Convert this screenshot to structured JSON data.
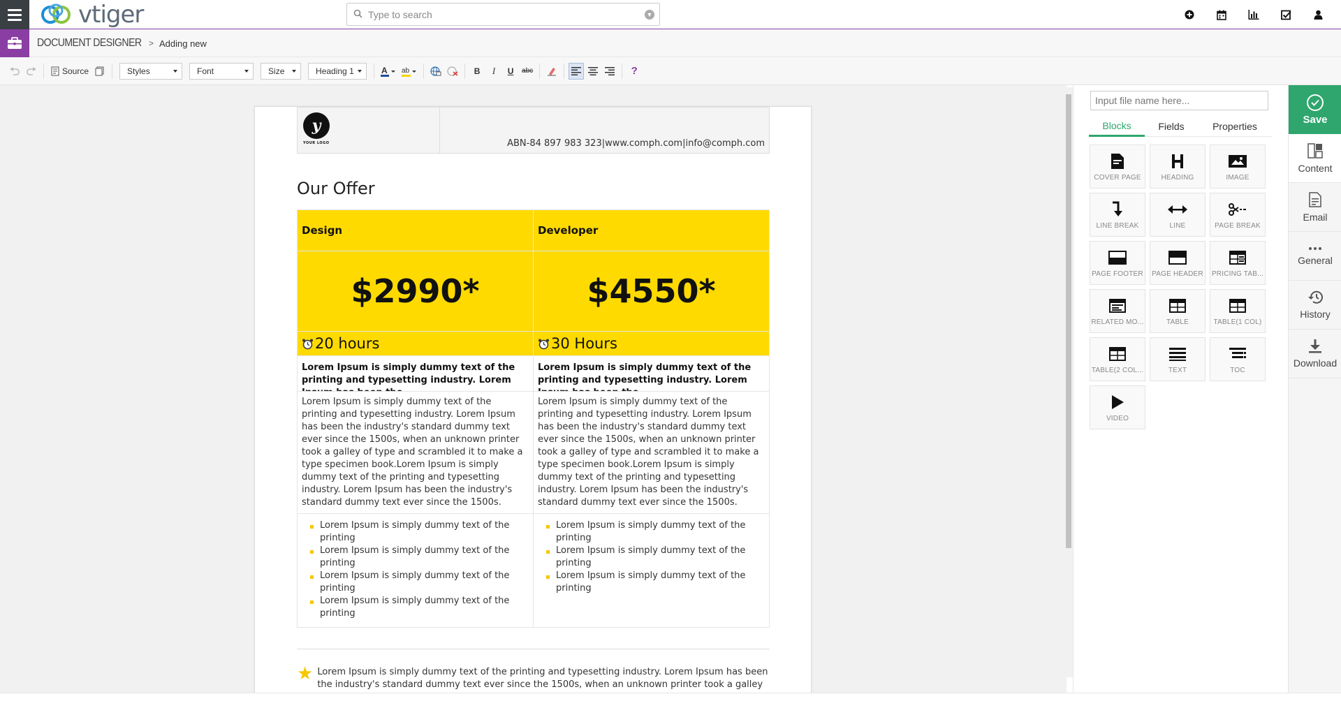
{
  "topbar": {
    "logo_text": "vtiger",
    "search_placeholder": "Type to search",
    "icons": [
      "plus-circle-icon",
      "calendar-icon",
      "bar-chart-icon",
      "check-square-icon",
      "user-icon"
    ]
  },
  "breadcrumb": {
    "module": "DOCUMENT DESIGNER",
    "separator": ">",
    "current": "Adding new"
  },
  "toolbar": {
    "source_label": "Source",
    "styles_label": "Styles",
    "font_label": "Font",
    "size_label": "Size",
    "format_label": "Heading 1",
    "bold": "B",
    "italic": "I",
    "underline": "U",
    "strike": "abc",
    "help": "?"
  },
  "document": {
    "contact_line": "ABN-84 897 983 323|www.comph.com|info@comph.com",
    "logo_letter": "y",
    "logo_caption": "YOUR LOGO",
    "title": "Our Offer",
    "plans": [
      {
        "name": "Design",
        "price": "$2990*",
        "hours": "20 hours",
        "lead": "Lorem Ipsum is simply dummy text of the printing and typesetting industry. Lorem Ipsum has been the",
        "body": "Lorem Ipsum is simply dummy text of the printing and typesetting industry. Lorem Ipsum has been the industry's standard dummy text ever since the 1500s, when an unknown printer took a galley of type and scrambled it to make a type specimen book.Lorem Ipsum is simply dummy text of the printing and typesetting industry. Lorem Ipsum has been the industry's standard dummy text ever since the 1500s.",
        "bullets": [
          "Lorem Ipsum is simply dummy text of the printing",
          "Lorem Ipsum is simply dummy text of the printing",
          "Lorem Ipsum is simply dummy text of the printing",
          "Lorem Ipsum is simply dummy text of the printing"
        ]
      },
      {
        "name": "Developer",
        "price": "$4550*",
        "hours": "30 Hours",
        "lead": "Lorem Ipsum is simply dummy text of the printing and typesetting industry. Lorem Ipsum has been the",
        "body": "Lorem Ipsum is simply dummy text of the printing and typesetting industry. Lorem Ipsum has been the industry's standard dummy text ever since the 1500s, when an unknown printer took a galley of type and scrambled it to make a type specimen book.Lorem Ipsum is simply dummy text of the printing and typesetting industry. Lorem Ipsum has been the industry's standard dummy text ever since the 1500s.",
        "bullets": [
          "Lorem Ipsum is simply dummy text of the printing",
          "Lorem Ipsum is simply dummy text of the printing",
          "Lorem Ipsum is simply dummy text of the printing"
        ]
      }
    ],
    "footer_note": "Lorem Ipsum is simply dummy text of the printing and typesetting industry. Lorem Ipsum has been the industry's standard dummy text ever since the 1500s, when an unknown printer took a galley of type and"
  },
  "panel": {
    "file_placeholder": "Input file name here...",
    "tabs": [
      "Blocks",
      "Fields",
      "Properties"
    ],
    "active_tab": "Blocks",
    "blocks": [
      {
        "label": "COVER PAGE",
        "icon": "cover-page-icon"
      },
      {
        "label": "HEADING",
        "icon": "heading-icon"
      },
      {
        "label": "IMAGE",
        "icon": "image-icon"
      },
      {
        "label": "LINE BREAK",
        "icon": "line-break-icon"
      },
      {
        "label": "LINE",
        "icon": "line-icon"
      },
      {
        "label": "PAGE BREAK",
        "icon": "page-break-icon"
      },
      {
        "label": "PAGE FOOTER",
        "icon": "page-footer-icon"
      },
      {
        "label": "PAGE HEADER",
        "icon": "page-header-icon"
      },
      {
        "label": "PRICING TAB...",
        "icon": "pricing-table-icon"
      },
      {
        "label": "RELATED MO...",
        "icon": "related-modules-icon"
      },
      {
        "label": "TABLE",
        "icon": "table-icon"
      },
      {
        "label": "TABLE(1 COL)",
        "icon": "table-1-col-icon"
      },
      {
        "label": "TABLE(2 COL...",
        "icon": "table-2-col-icon"
      },
      {
        "label": "TEXT",
        "icon": "text-icon"
      },
      {
        "label": "TOC",
        "icon": "toc-icon"
      },
      {
        "label": "VIDEO",
        "icon": "video-icon"
      }
    ]
  },
  "actions": {
    "save": "Save",
    "items": [
      {
        "label": "Content",
        "icon": "content-icon"
      },
      {
        "label": "Email",
        "icon": "email-icon"
      },
      {
        "label": "General",
        "icon": "more-dots-icon"
      },
      {
        "label": "History",
        "icon": "history-icon"
      },
      {
        "label": "Download",
        "icon": "download-icon"
      }
    ]
  },
  "colors": {
    "accent_purple": "#8a3ea3",
    "save_green": "#2ea66d",
    "pricing_yellow": "#ffda00"
  }
}
